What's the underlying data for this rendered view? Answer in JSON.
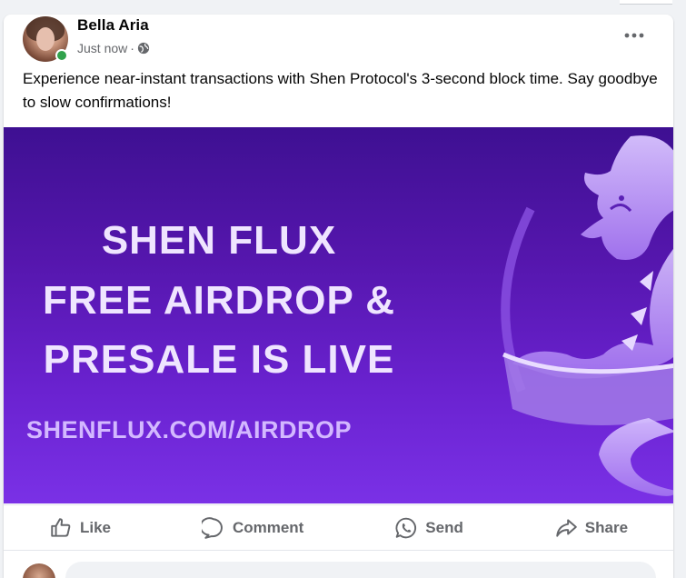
{
  "post": {
    "author": "Bella Aria",
    "timestamp": "Just now",
    "separator": "·",
    "privacy_icon": "globe-icon",
    "more_icon": "ellipsis-icon",
    "text": "Experience near-instant transactions with Shen Protocol's 3-second block time. Say goodbye to slow confirmations!",
    "online": true
  },
  "image": {
    "line1": "SHEN FLUX",
    "line2": "FREE AIRDROP &",
    "line3": "PRESALE IS LIVE",
    "url": "SHENFLUX.COM/AIRDROP",
    "logo": "dragon-logo"
  },
  "actions": {
    "like": "Like",
    "comment": "Comment",
    "send": "Send",
    "share": "Share"
  },
  "colors": {
    "accent_purple": "#6a22d0",
    "online_green": "#31a24c",
    "muted_text": "#65676b"
  }
}
